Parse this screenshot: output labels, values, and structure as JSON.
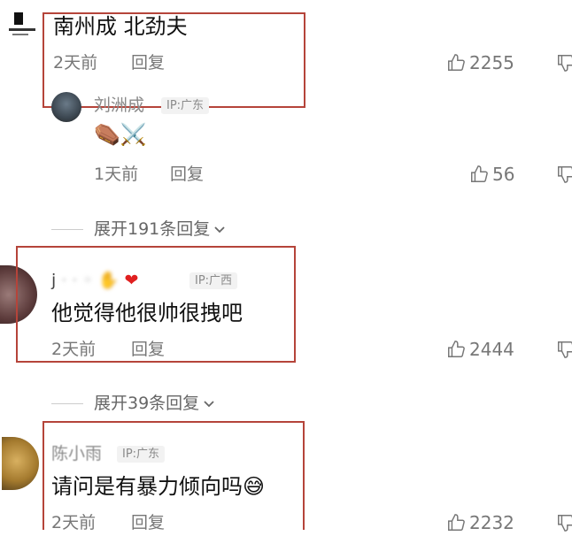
{
  "comments": [
    {
      "text": "南州成  北劲夫",
      "time": "2天前",
      "reply_label": "回复",
      "likes": "2255"
    },
    {
      "username": "刘洲成",
      "ip": "IP:广东",
      "emojis": "⚰️⚔️",
      "time": "1天前",
      "reply_label": "回复",
      "likes": "56"
    },
    {
      "username": "j",
      "ip": "IP:广西",
      "text": "他觉得他很帅很拽吧",
      "time": "2天前",
      "reply_label": "回复",
      "likes": "2444"
    },
    {
      "username": "陈小雨",
      "ip": "IP:广东",
      "text": "请问是有暴力倾向吗",
      "time": "2天前",
      "reply_label": "回复",
      "likes": "2232"
    }
  ],
  "expand": [
    {
      "label": "展开191条回复"
    },
    {
      "label": "展开39条回复"
    }
  ],
  "colors": {
    "highlight_box": "#b5443a",
    "meta_text": "#777777"
  }
}
